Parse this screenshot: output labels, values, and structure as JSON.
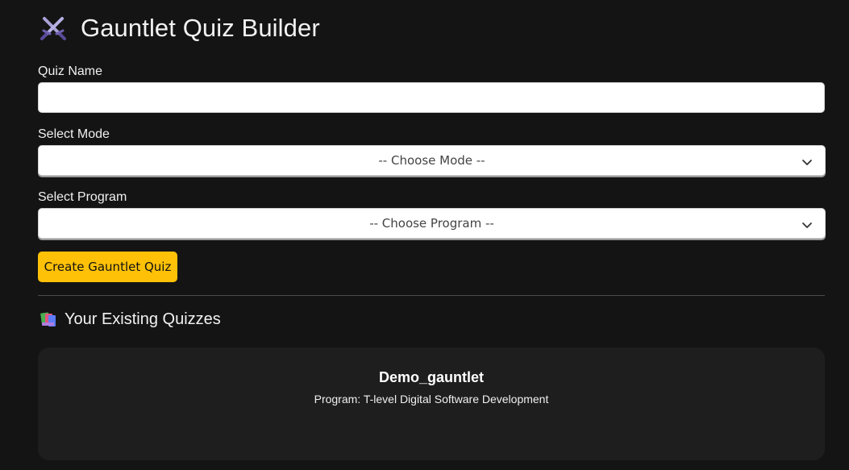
{
  "header": {
    "title": "Gauntlet Quiz Builder",
    "icon": "crossed-swords-icon"
  },
  "form": {
    "quiz_name": {
      "label": "Quiz Name",
      "value": "",
      "placeholder": ""
    },
    "mode": {
      "label": "Select Mode",
      "selected": "-- Choose Mode --"
    },
    "program": {
      "label": "Select Program",
      "selected": "-- Choose Program --"
    },
    "create_button_label": "Create Gauntlet Quiz"
  },
  "existing": {
    "icon": "books-icon",
    "title": "Your Existing Quizzes",
    "quizzes": [
      {
        "name": "Demo_gauntlet",
        "program": "Program: T-level Digital Software Development"
      }
    ]
  },
  "colors": {
    "background": "#141414",
    "card": "#1e1e1e",
    "accent": "#ffc107"
  }
}
